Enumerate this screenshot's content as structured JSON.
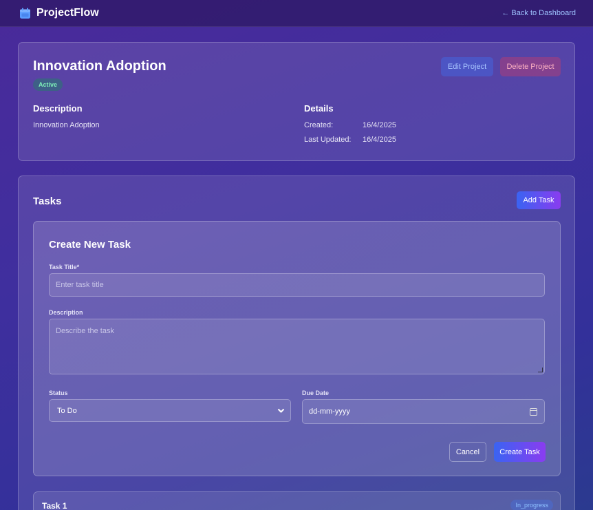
{
  "nav": {
    "app_name": "ProjectFlow",
    "back_link": "← Back to Dashboard"
  },
  "project": {
    "title": "Innovation Adoption",
    "status": "Active",
    "edit_label": "Edit Project",
    "delete_label": "Delete Project",
    "description_heading": "Description",
    "description": "Innovation Adoption",
    "details_heading": "Details",
    "created_label": "Created:",
    "created_value": "16/4/2025",
    "updated_label": "Last Updated:",
    "updated_value": "16/4/2025"
  },
  "tasks": {
    "heading": "Tasks",
    "add_label": "Add Task",
    "form": {
      "title": "Create New Task",
      "title_label": "Task Title*",
      "title_placeholder": "Enter task title",
      "description_label": "Description",
      "description_placeholder": "Describe the task",
      "status_label": "Status",
      "status_value": "To Do",
      "due_label": "Due Date",
      "due_placeholder": "dd-mm-yyyy",
      "cancel_label": "Cancel",
      "create_label": "Create Task"
    },
    "items": [
      {
        "title": "Task 1",
        "status": "In_progress"
      }
    ]
  },
  "colors": {
    "accent_start": "#3a64f2",
    "accent_end": "#8a3cf0",
    "active_badge": "#7ef0b8",
    "link": "#9ec3ff"
  },
  "icons": {
    "brand": "calendar-icon",
    "status_select": "chevron-down-icon",
    "due_date": "calendar-icon"
  }
}
